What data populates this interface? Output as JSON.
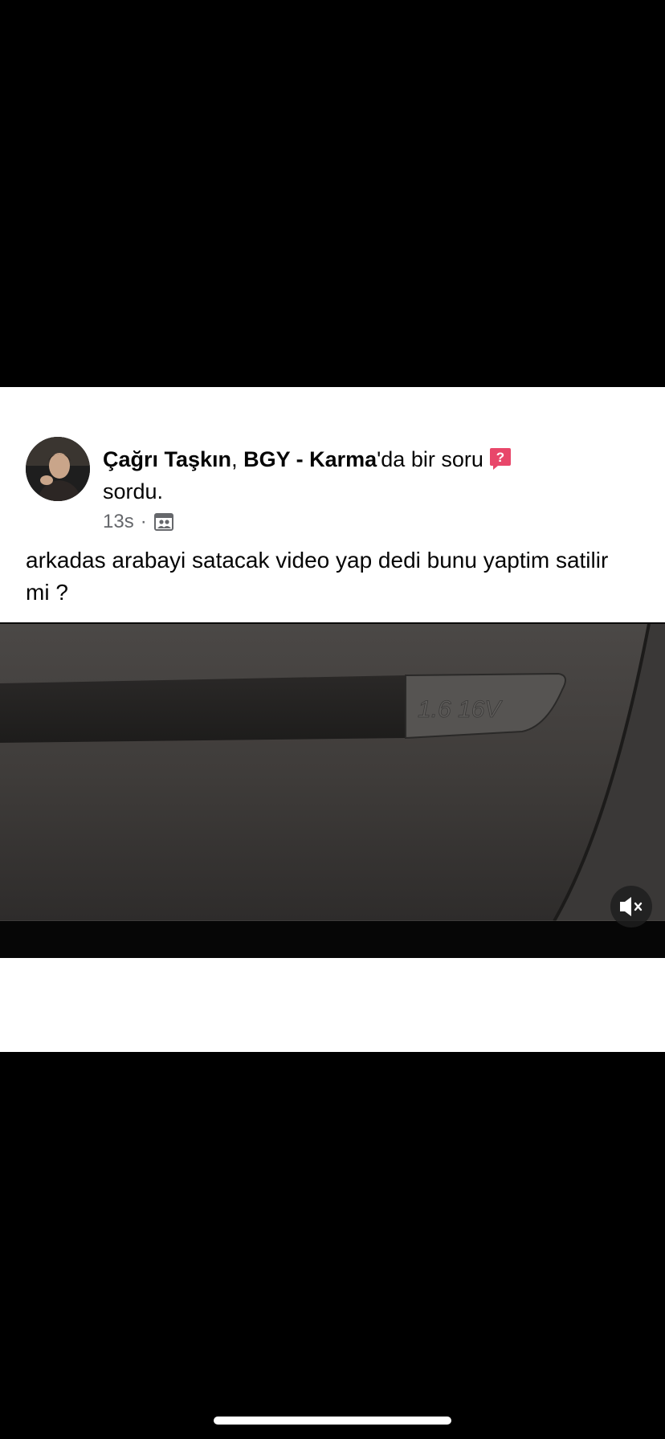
{
  "post": {
    "author": "Çağrı Taşkın",
    "separator": ", ",
    "group": "BGY - Karma",
    "action_suffix": "'da bir soru",
    "action_end": "sordu.",
    "time": "13s",
    "dot": "·",
    "body": "arkadas arabayi satacak video yap dedi bunu yaptim satilir mi ?",
    "audience_icon": "group-members-icon",
    "question_icon": "question-badge-icon",
    "accent_color": "#e8476a"
  },
  "video": {
    "badge_text": "1.6 16V",
    "mute_icon": "speaker-muted-icon"
  }
}
